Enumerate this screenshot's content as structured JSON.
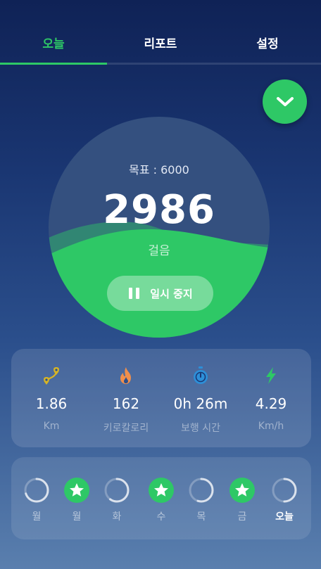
{
  "tabs": [
    {
      "label": "오늘",
      "active": true
    },
    {
      "label": "리포트",
      "active": false
    },
    {
      "label": "설정",
      "active": false
    }
  ],
  "colors": {
    "accent": "#2ec866",
    "background": "#1a3672"
  },
  "goal": {
    "label": "목표 : 6000",
    "target": 6000
  },
  "steps": {
    "value": "2986",
    "unit": "걸음",
    "progress_fraction": 0.498
  },
  "pause_button": {
    "label": "일시 중지",
    "icon": "pause-icon"
  },
  "collapse_button": {
    "icon": "chevron-down-icon"
  },
  "stats": [
    {
      "icon": "route-icon",
      "value": "1.86",
      "label": "Km"
    },
    {
      "icon": "flame-icon",
      "value": "162",
      "label": "키로칼로리"
    },
    {
      "icon": "stopwatch-icon",
      "value": "0h 26m",
      "label": "보행 시간"
    },
    {
      "icon": "lightning-icon",
      "value": "4.29",
      "label": "Km/h"
    }
  ],
  "week": [
    {
      "label": "월",
      "completed": false,
      "progress": 0.7,
      "today": false
    },
    {
      "label": "월",
      "completed": true,
      "progress": 1,
      "today": false
    },
    {
      "label": "화",
      "completed": false,
      "progress": 0.6,
      "today": false
    },
    {
      "label": "수",
      "completed": true,
      "progress": 1,
      "today": false
    },
    {
      "label": "목",
      "completed": false,
      "progress": 0.55,
      "today": false
    },
    {
      "label": "금",
      "completed": true,
      "progress": 1,
      "today": false
    },
    {
      "label": "오늘",
      "completed": false,
      "progress": 0.5,
      "today": true
    }
  ]
}
